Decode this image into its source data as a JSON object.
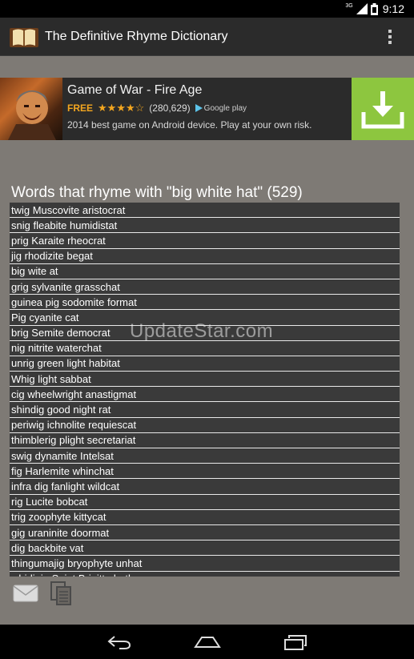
{
  "status_bar": {
    "time": "9:12",
    "network_label": "3G"
  },
  "app": {
    "title": "The Definitive Rhyme Dictionary"
  },
  "ad": {
    "title": "Game of War - Fire Age",
    "free_label": "FREE",
    "rating_stars": 4.5,
    "reviews": "(280,629)",
    "store_badge": "Google play",
    "description": "2014 best game on Android device. Play at your own risk.",
    "download_color": "#8dc63f"
  },
  "results": {
    "heading": "Words that rhyme with \"big white hat\" (529)",
    "rows": [
      "twig Muscovite aristocrat",
      "snig fleabite humidistat",
      "prig Karaite rheocrat",
      "jig rhodizite begat",
      "big wite at",
      "grig sylvanite grasschat",
      "guinea pig sodomite format",
      "Pig cyanite cat",
      "brig Semite democrat",
      "nig nitrite waterchat",
      "unrig green light habitat",
      "Whig light sabbat",
      "cig wheelwright anastigmat",
      "shindig good night rat",
      "periwig ichnolite requiescat",
      "thimblerig plight secretariat",
      "swig dynamite Intelsat",
      "fig Harlemite whinchat",
      "infra dig fanlight wildcat",
      "rig Lucite bobcat",
      "trig zoophyte kittycat",
      "gig uraninite doormat",
      "dig backbite vat",
      "thingumajig bryophyte unhat",
      "whirligig Saint Brigitte bath"
    ]
  },
  "watermark": "UpdateStar.com",
  "icons": {
    "email": "envelope-icon",
    "copy": "copy-icon",
    "back": "back-icon",
    "home": "home-icon",
    "recents": "recents-icon"
  }
}
